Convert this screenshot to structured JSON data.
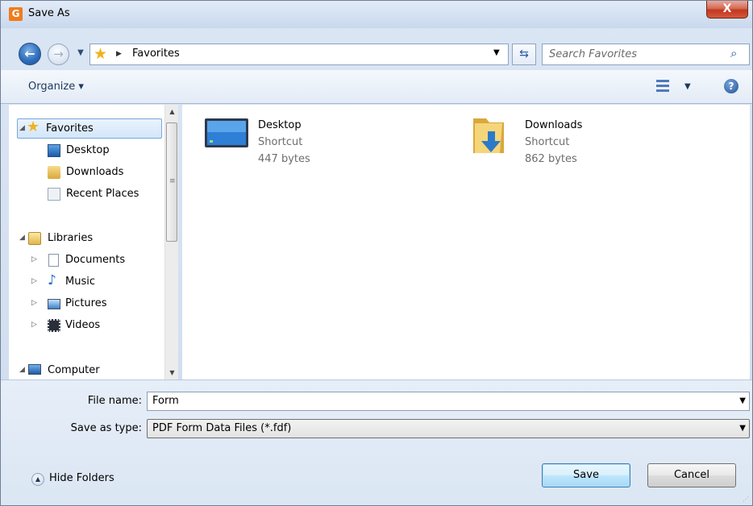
{
  "window": {
    "title": "Save As",
    "app_icon_letter": "G",
    "close_glyph": "X"
  },
  "address": {
    "back_glyph": "←",
    "forward_glyph": "→",
    "location": "Favorites",
    "refresh_glyph": "⇆"
  },
  "search": {
    "placeholder": "Search Favorites",
    "icon": "search-icon"
  },
  "toolbar": {
    "organize_label": "Organize ▾",
    "view_icon": "view-options-icon",
    "help_glyph": "?"
  },
  "nav": {
    "favorites": {
      "label": "Favorites",
      "items": [
        {
          "label": "Desktop",
          "icon": "desktop-icon"
        },
        {
          "label": "Downloads",
          "icon": "downloads-icon"
        },
        {
          "label": "Recent Places",
          "icon": "recent-places-icon"
        }
      ]
    },
    "libraries": {
      "label": "Libraries",
      "items": [
        {
          "label": "Documents",
          "icon": "documents-icon"
        },
        {
          "label": "Music",
          "icon": "music-icon"
        },
        {
          "label": "Pictures",
          "icon": "pictures-icon"
        },
        {
          "label": "Videos",
          "icon": "videos-icon"
        }
      ]
    },
    "computer": {
      "label": "Computer"
    }
  },
  "files": [
    {
      "name": "Desktop",
      "kind": "Shortcut",
      "size": "447 bytes",
      "icon": "desktop-shortcut-icon"
    },
    {
      "name": "Downloads",
      "kind": "Shortcut",
      "size": "862 bytes",
      "icon": "downloads-folder-icon"
    }
  ],
  "form": {
    "file_name_label": "File name:",
    "file_name_value": "Form",
    "save_type_label": "Save as type:",
    "save_type_value": "PDF Form Data Files (*.fdf)"
  },
  "footer": {
    "hide_folders_label": "Hide Folders",
    "save_label": "Save",
    "cancel_label": "Cancel"
  },
  "colors": {
    "accent": "#3c7fb1",
    "app_icon": "#f07c1c",
    "close": "#c1381f",
    "selection": "#d3e6fa"
  }
}
